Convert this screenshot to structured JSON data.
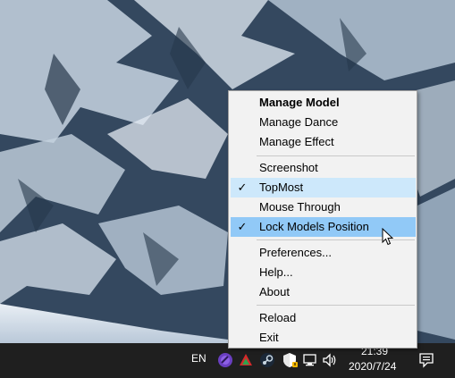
{
  "context_menu": {
    "items": [
      {
        "label": "Manage Model",
        "bold": true,
        "checked": false
      },
      {
        "label": "Manage Dance",
        "bold": false,
        "checked": false
      },
      {
        "label": "Manage Effect",
        "bold": false,
        "checked": false
      },
      {
        "label": "Screenshot",
        "bold": false,
        "checked": false
      },
      {
        "label": "TopMost",
        "bold": false,
        "checked": true
      },
      {
        "label": "Mouse Through",
        "bold": false,
        "checked": false
      },
      {
        "label": "Lock Models Position",
        "bold": false,
        "checked": true,
        "hovered": true
      },
      {
        "label": "Preferences...",
        "bold": false,
        "checked": false
      },
      {
        "label": "Help...",
        "bold": false,
        "checked": false
      },
      {
        "label": "About",
        "bold": false,
        "checked": false
      },
      {
        "label": "Reload",
        "bold": false,
        "checked": false
      },
      {
        "label": "Exit",
        "bold": false,
        "checked": false
      }
    ],
    "check_glyph": "✓"
  },
  "taskbar": {
    "language": "EN",
    "clock_time": "21:39",
    "clock_date": "2020/7/24",
    "tray_icons": [
      "obs-icon",
      "red-app-icon",
      "steam-icon",
      "security-shield-icon",
      "network-icon",
      "volume-icon"
    ],
    "notification_icon": "action-center-icon"
  },
  "colors": {
    "menu_background": "#f2f2f2",
    "menu_hover": "#91c9f7",
    "menu_checked": "#cde8fb",
    "taskbar_background": "#1f1f1f"
  }
}
